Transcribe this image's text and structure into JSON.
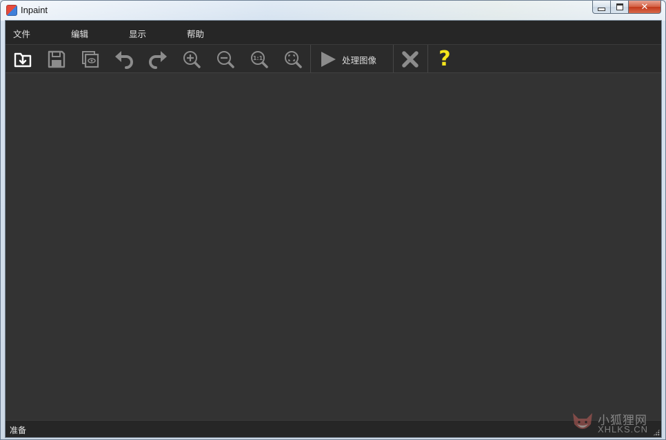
{
  "window": {
    "title": "Inpaint",
    "icons": {
      "app": "inpaint-app-icon",
      "minimize": "minimize-icon",
      "maximize": "maximize-icon",
      "close": "close-x-icon"
    }
  },
  "menu": {
    "items": [
      {
        "id": "file",
        "label": "文件"
      },
      {
        "id": "edit",
        "label": "编辑"
      },
      {
        "id": "view",
        "label": "显示"
      },
      {
        "id": "help",
        "label": "帮助"
      }
    ]
  },
  "toolbar": {
    "buttons": [
      {
        "id": "open",
        "icon": "open-folder-icon"
      },
      {
        "id": "save",
        "icon": "save-disk-icon"
      },
      {
        "id": "preview",
        "icon": "preview-eye-icon"
      },
      {
        "id": "undo",
        "icon": "undo-arrow-icon"
      },
      {
        "id": "redo",
        "icon": "redo-arrow-icon"
      },
      {
        "id": "zoom-in",
        "icon": "zoom-in-icon"
      },
      {
        "id": "zoom-out",
        "icon": "zoom-out-icon"
      },
      {
        "id": "zoom-actual",
        "icon": "zoom-actual-size-icon",
        "label": "1:1"
      },
      {
        "id": "zoom-fit",
        "icon": "zoom-fit-icon"
      }
    ],
    "process_label": "处理图像",
    "process_icon": "play-triangle-icon",
    "cancel_icon": "cancel-x-icon",
    "help_icon": "question-mark-icon",
    "help_glyph": "?"
  },
  "status": {
    "text": "准备"
  },
  "watermark": {
    "line1": "小狐狸网",
    "line2": "XHLKS.CN"
  },
  "colors": {
    "client_bg": "#333333",
    "bar_bg": "#262626",
    "icon_gray": "#8c8c8c",
    "help_yellow": "#f5e51c",
    "text": "#e6e6e6"
  }
}
